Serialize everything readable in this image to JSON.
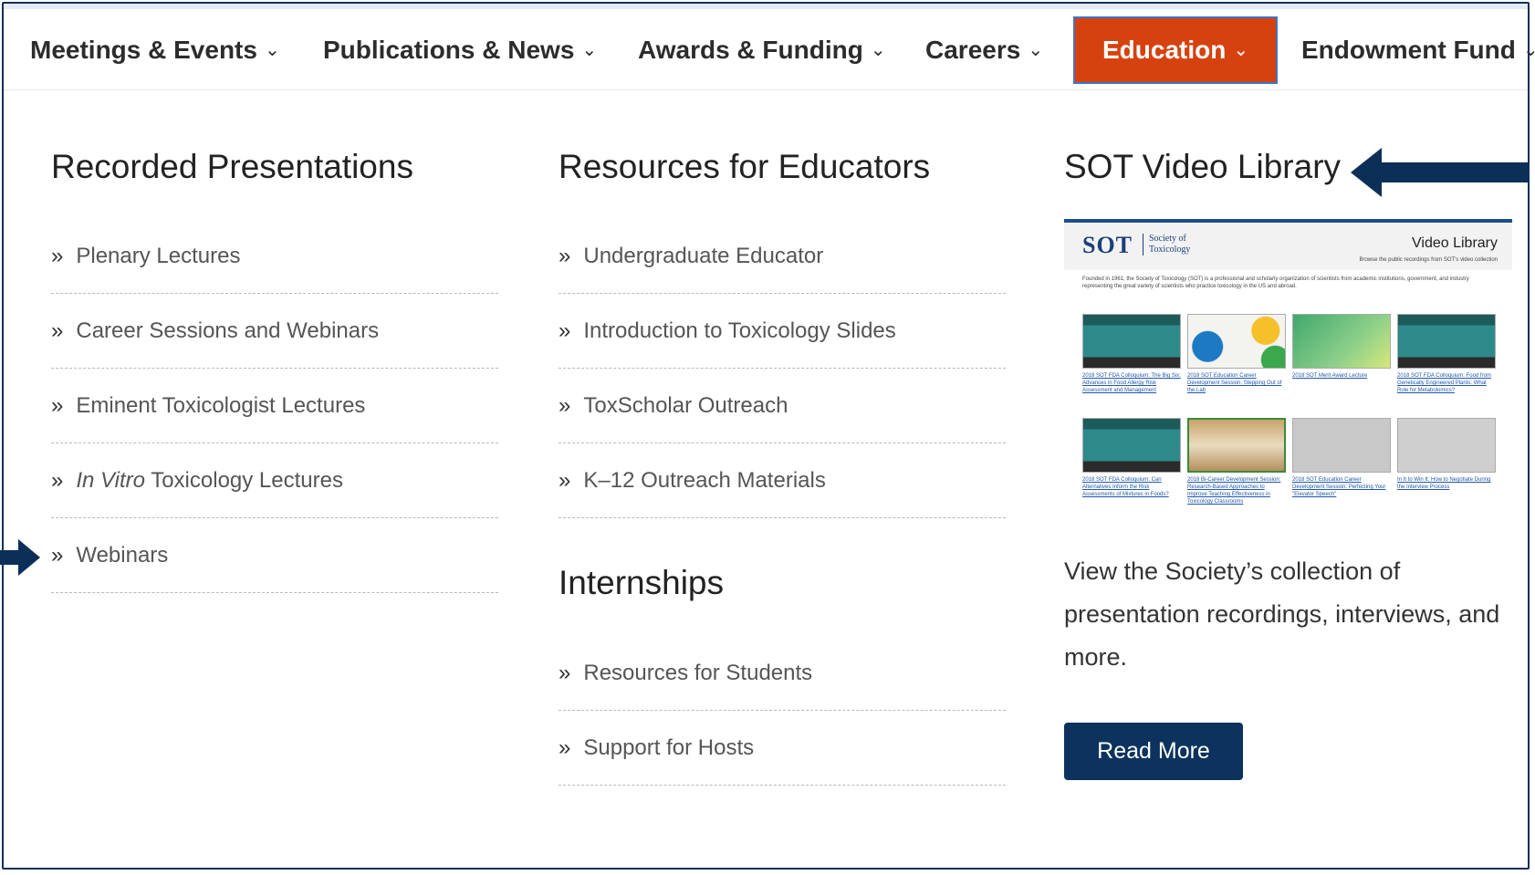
{
  "nav": {
    "items": [
      {
        "label": "Meetings & Events",
        "chevron": "chevron-down-icon"
      },
      {
        "label": "Publications & News",
        "chevron": "chevron-down-icon"
      },
      {
        "label": "Awards & Funding",
        "chevron": "chevron-down-icon"
      },
      {
        "label": "Careers",
        "chevron": "chevron-down-icon"
      },
      {
        "label": "Education",
        "chevron": "chevron-down-icon",
        "active": true
      },
      {
        "label": "Endowment Fund",
        "chevron": "chevron-down-icon"
      }
    ],
    "active_color": "#d6420f"
  },
  "recorded": {
    "title": "Recorded Presentations",
    "links": [
      {
        "label": "Plenary Lectures"
      },
      {
        "label": "Career Sessions and Webinars"
      },
      {
        "label": "Eminent Toxicologist Lectures"
      },
      {
        "label_italic": "In Vitro",
        "label_rest": " Toxicology Lectures"
      },
      {
        "label": "Webinars"
      }
    ]
  },
  "educators": {
    "title": "Resources for Educators",
    "links": [
      {
        "label": "Undergraduate Educator"
      },
      {
        "label": "Introduction to Toxicology Slides"
      },
      {
        "label": "ToxScholar Outreach"
      },
      {
        "label": "K–12 Outreach Materials"
      }
    ]
  },
  "internships": {
    "title": "Internships",
    "links": [
      {
        "label": "Resources for Students"
      },
      {
        "label": "Support for Hosts"
      }
    ]
  },
  "video_library": {
    "title": "SOT Video Library",
    "thumb": {
      "logo": "SOT",
      "logo_sub_1": "Society of",
      "logo_sub_2": "Toxicology",
      "heading": "Video Library",
      "tagline": "Browse the public recordings from SOT's video collection",
      "intro": "Founded in 1961, the Society of Toxicology (SOT) is a professional and scholarly organization of scientists from academic institutions, government, and industry representing the great variety of scientists who practice toxicology in the US and abroad.",
      "captions": [
        "2018 SOT FDA Colloquium: The Big Six: Advances in Food Allergy Risk Assessment and Management",
        "2018 SOT Education Career Development Session: Stepping Out of the Lab",
        "2018 SOT Merit Award Lecture",
        "2018 SOT FDA Colloquium: Food from Genetically Engineered Plants: What Role for Metabolomics?",
        "2018 SOT FDA Colloquium: Can Alternatives Inform the Risk Assessments of Mixtures in Foods?",
        "2018 Bi-Career Development Session: Research-Based Approaches to Improve Teaching Effectiveness in Toxicology Classrooms",
        "2018 SOT Education Career Development Session: Perfecting Your \"Elevator Speech\"",
        "In It to Win It: How to Negotiate During the Interview Process"
      ]
    },
    "description": "View the Society’s collection of presentation recordings, interviews, and more.",
    "button_label": "Read More"
  },
  "colors": {
    "button": "#0c335d",
    "arrow": "#0c2f57",
    "frame": "#0d2f5a"
  }
}
